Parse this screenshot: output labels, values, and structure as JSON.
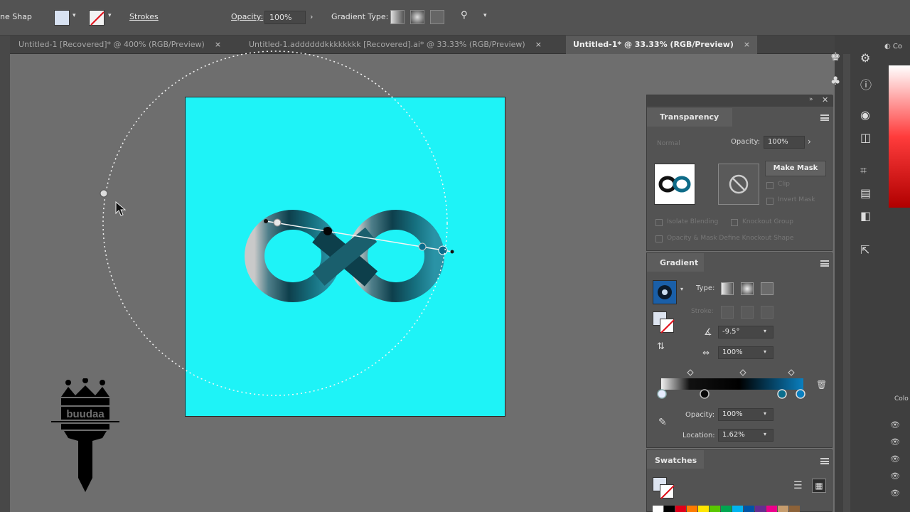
{
  "control_bar": {
    "shape_label": "ne Shap",
    "strokes_label": "Strokes",
    "opacity_label": "Opacity:",
    "opacity_value": "100%",
    "gradient_type_label": "Gradient Type:"
  },
  "tabs": [
    {
      "label": "Untitled-1 [Recovered]* @ 400% (RGB/Preview)",
      "active": false
    },
    {
      "label": "Untitled-1.addddddkkkkkkkk [Recovered].ai* @ 33.33% (RGB/Preview)",
      "active": false
    },
    {
      "label": "Untitled-1* @ 33.33% (RGB/Preview)",
      "active": true
    }
  ],
  "tab_close_glyph": "×",
  "transparency": {
    "title": "Transparency",
    "blend_mode": "Normal",
    "opacity_label": "Opacity:",
    "opacity_value": "100%",
    "make_mask": "Make Mask",
    "clip_label": "Clip",
    "invert_mask_label": "Invert Mask",
    "isolate_blending": "Isolate Blending",
    "knockout_group": "Knockout Group",
    "opacity_mask_text": "Opacity & Mask Define Knockout Shape"
  },
  "gradient": {
    "title": "Gradient",
    "type_label": "Type:",
    "stroke_label": "Stroke:",
    "angle_value": "-9.5°",
    "aspect_value": "100%",
    "opacity_label": "Opacity:",
    "opacity_value": "100%",
    "location_label": "Location:",
    "location_value": "1.62%"
  },
  "swatches": {
    "title": "Swatches",
    "colors": [
      "#ffffff",
      "#000000",
      "#e1001a",
      "#ff7a00",
      "#ffe600",
      "#59c700",
      "#00a651",
      "#00b4f0",
      "#0054a6",
      "#662d91",
      "#ec008c",
      "#c69c6d",
      "#8c6239"
    ]
  },
  "logo_text": "buudaa",
  "colors": {
    "artboard": "#1ef3f7",
    "gradient_end": "#0a7fbf"
  }
}
